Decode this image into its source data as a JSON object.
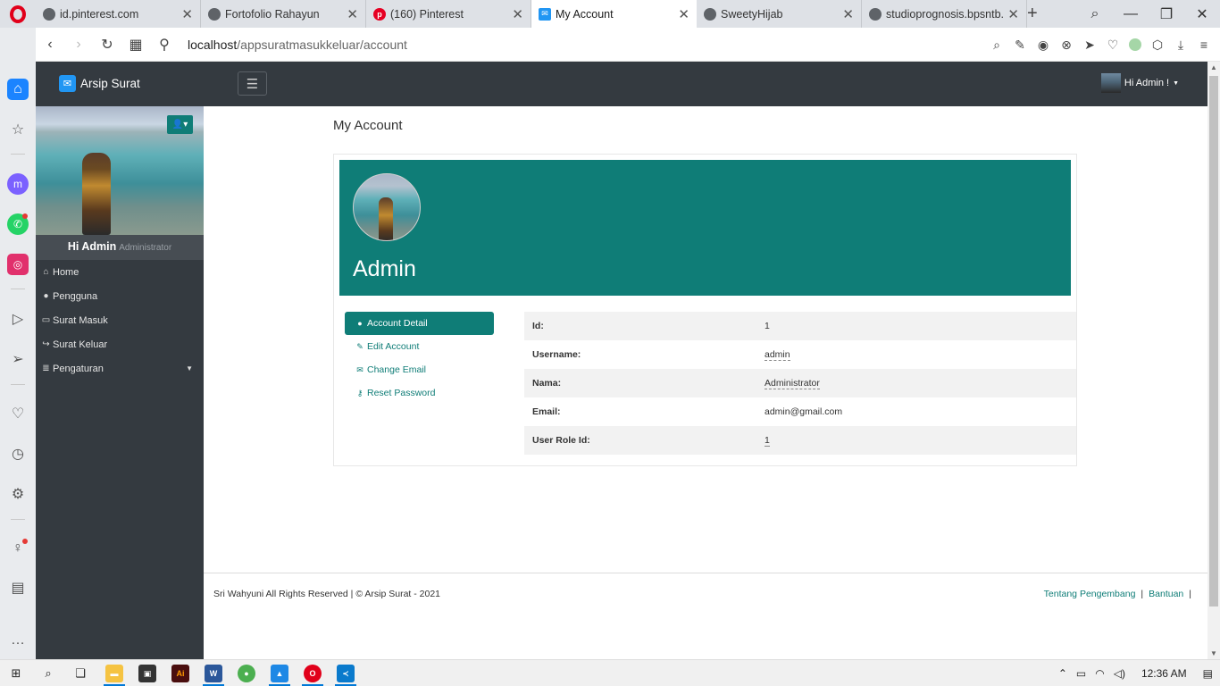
{
  "browser": {
    "tabs": [
      {
        "title": "id.pinterest.com",
        "favicon": "globe-icon"
      },
      {
        "title": "Fortofolio Rahayun",
        "favicon": "globe-icon"
      },
      {
        "title": "(160) Pinterest",
        "favicon": "pinterest-icon"
      },
      {
        "title": "My Account",
        "favicon": "mail-icon",
        "active": true
      },
      {
        "title": "SweetyHijab",
        "favicon": "globe-icon"
      },
      {
        "title": "studioprognosis.bpsntb.",
        "favicon": "globe-icon"
      }
    ],
    "url_host": "localhost",
    "url_path": "/appsuratmasukkeluar/account"
  },
  "app": {
    "brand": "Arsip Surat",
    "user_menu": "Hi Admin !",
    "accent_color": "#0f7d77",
    "sidebar": {
      "greeting": "Hi Admin",
      "role": "Administrator",
      "items": [
        {
          "label": "Home",
          "icon": "home-icon"
        },
        {
          "label": "Pengguna",
          "icon": "user-icon"
        },
        {
          "label": "Surat Masuk",
          "icon": "inbox-icon"
        },
        {
          "label": "Surat Keluar",
          "icon": "share-icon"
        },
        {
          "label": "Pengaturan",
          "icon": "database-icon",
          "has_caret": true
        }
      ]
    }
  },
  "page": {
    "title": "My Account",
    "profile_name": "Admin",
    "tabs": [
      {
        "label": "Account Detail",
        "icon": "user-icon"
      },
      {
        "label": "Edit Account",
        "icon": "edit-icon"
      },
      {
        "label": "Change Email",
        "icon": "envelope-icon"
      },
      {
        "label": "Reset Password",
        "icon": "key-icon"
      }
    ],
    "details": [
      {
        "label": "Id:",
        "value": "1"
      },
      {
        "label": "Username:",
        "value": "admin"
      },
      {
        "label": "Nama:",
        "value": "Administrator"
      },
      {
        "label": "Email:",
        "value": "admin@gmail.com"
      },
      {
        "label": "User Role Id:",
        "value": "1"
      }
    ]
  },
  "footer": {
    "copyright": "Sri Wahyuni All Rights Reserved | © Arsip Surat - 2021",
    "link1": "Tentang Pengembang",
    "link2": "Bantuan",
    "separator": "|"
  },
  "taskbar": {
    "clock": "12:36 AM"
  }
}
